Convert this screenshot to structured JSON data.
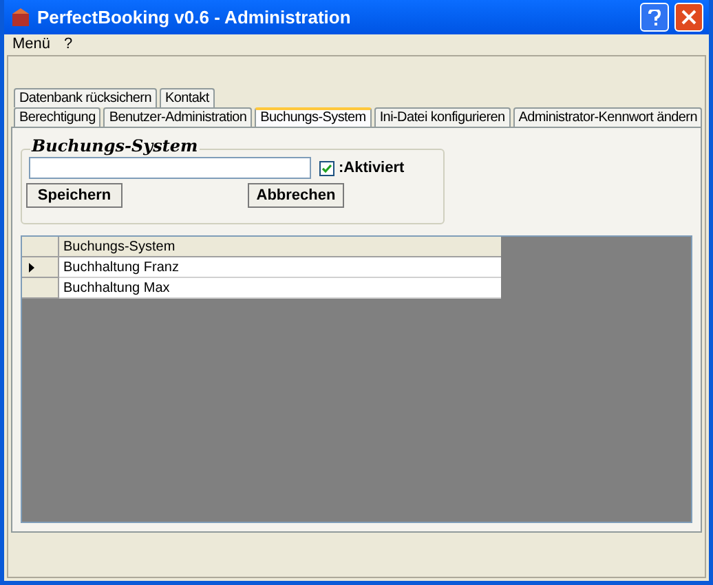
{
  "window": {
    "title": "PerfectBooking v0.6 - Administration"
  },
  "menu": [
    "Menü",
    "?"
  ],
  "tab_rows": [
    [
      {
        "label": "Datenbank rücksichern",
        "selected": false
      },
      {
        "label": "Kontakt",
        "selected": false
      }
    ],
    [
      {
        "label": "Berechtigung",
        "selected": false
      },
      {
        "label": "Benutzer-Administration",
        "selected": false
      },
      {
        "label": "Buchungs-System",
        "selected": true
      },
      {
        "label": "Ini-Datei konfigurieren",
        "selected": false
      },
      {
        "label": "Administrator-Kennwort ändern",
        "selected": false
      }
    ]
  ],
  "group": {
    "title": "Buchungs-System",
    "activated": {
      "label": ":Aktiviert",
      "checked": true
    },
    "buttons": [
      "Speichern",
      "Abbrechen"
    ]
  },
  "table": {
    "columns": [
      "Buchungs-System"
    ],
    "rows": [
      {
        "cells": [
          "Buchhaltung Franz"
        ],
        "selected": true
      },
      {
        "cells": [
          "Buchhaltung Max"
        ],
        "selected": false
      }
    ]
  }
}
